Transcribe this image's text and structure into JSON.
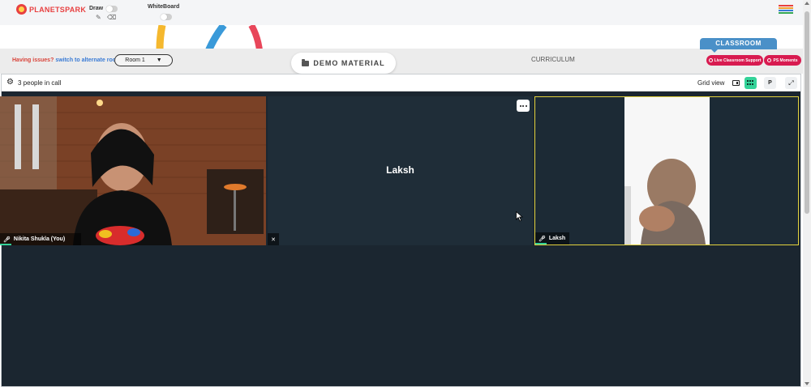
{
  "brand": {
    "logo_text": "PLANETSPARK"
  },
  "topbar": {
    "draw_label": "Draw",
    "whiteboard_label": "WhiteBoard",
    "pencil_icon": "pencil-icon",
    "eraser_icon": "eraser-icon",
    "menu_icon": "hamburger-menu-icon",
    "draw_enabled": false,
    "whiteboard_enabled": false
  },
  "toolbar": {
    "issue_prefix": "Having issues?",
    "issue_link": "switch to alternate room",
    "room_select": "Room 1",
    "demo_material": "DEMO MATERIAL",
    "curriculum": "CURRICULUM",
    "classroom_tab": "CLASSROOM",
    "live_support": "Live Classroom Support",
    "ps_moments": "PS Moments"
  },
  "call": {
    "people_count": "3 people in call",
    "grid_view_label": "Grid view",
    "p_button": "P",
    "participants": [
      {
        "name": "Nikita Shukla (You)",
        "video": true,
        "mic": "on"
      },
      {
        "name": "Laksh",
        "video": false,
        "mic": "muted"
      },
      {
        "name": "Laksh",
        "video": true,
        "mic": "on",
        "speaking": true
      }
    ]
  },
  "colors": {
    "brand_red": "#e84040",
    "pill_red": "#d81b50",
    "classroom_blue": "#4a90c8",
    "grid_active": "#34d399",
    "active_speaker_border": "#e3d23d",
    "call_bg": "#1b2630"
  }
}
